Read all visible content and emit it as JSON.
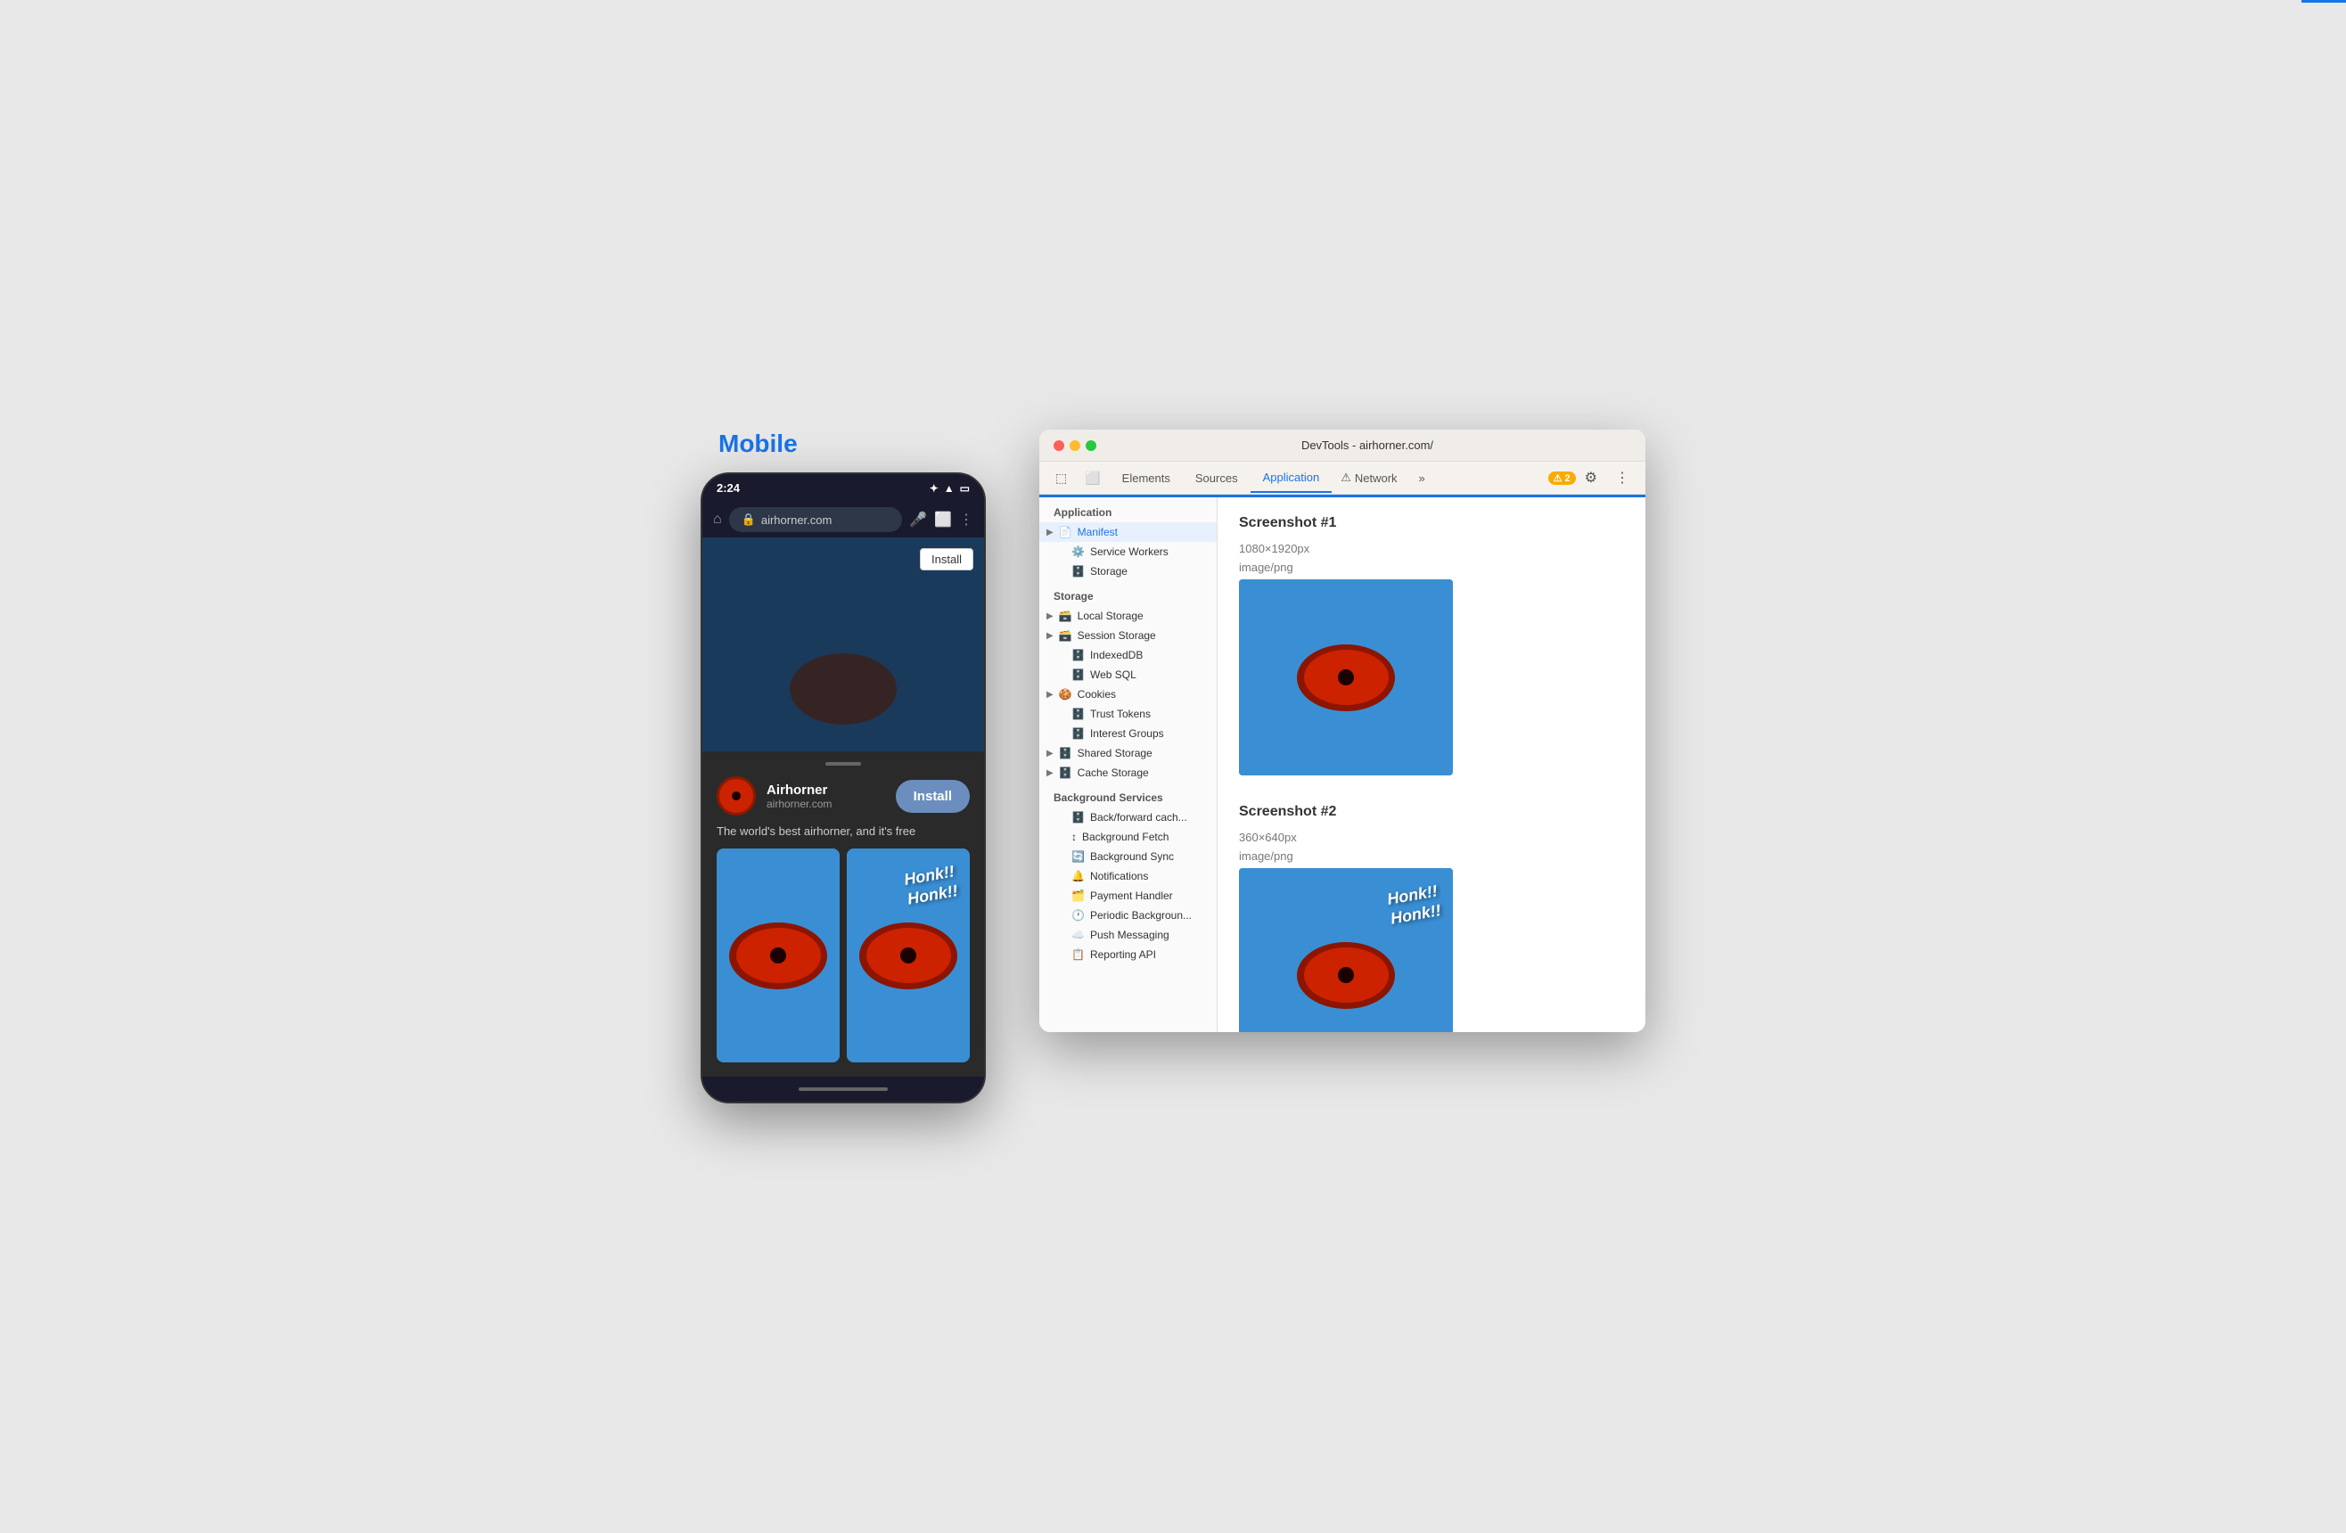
{
  "page": {
    "mobile_label": "Mobile"
  },
  "phone": {
    "status_time": "2:24",
    "url": "airhorner.com",
    "install_small": "Install",
    "app_name": "Airhorner",
    "app_url": "airhorner.com",
    "install_large": "Install",
    "description": "The world's best airhorner, and it's free",
    "honk_text_1": "Honk!!\nHonk!!",
    "honk_text_2": "Honk!!\nHonk!!"
  },
  "devtools": {
    "title": "DevTools - airhorner.com/",
    "tabs": [
      {
        "label": "Elements",
        "active": false
      },
      {
        "label": "Sources",
        "active": false
      },
      {
        "label": "Application",
        "active": true
      },
      {
        "label": "Network",
        "active": false
      }
    ],
    "warning_count": "⚠ 2",
    "sidebar": {
      "sections": [
        {
          "label": "Application",
          "items": [
            {
              "label": "Manifest",
              "icon": "📄",
              "expandable": true,
              "selected": false
            },
            {
              "label": "Service Workers",
              "icon": "⚙️",
              "expandable": false,
              "selected": false
            },
            {
              "label": "Storage",
              "icon": "🗄️",
              "expandable": false,
              "selected": false
            }
          ]
        },
        {
          "label": "Storage",
          "items": [
            {
              "label": "Local Storage",
              "icon": "🗃️",
              "expandable": true,
              "selected": false
            },
            {
              "label": "Session Storage",
              "icon": "🗃️",
              "expandable": true,
              "selected": false
            },
            {
              "label": "IndexedDB",
              "icon": "🗄️",
              "expandable": false,
              "selected": false
            },
            {
              "label": "Web SQL",
              "icon": "🗄️",
              "expandable": false,
              "selected": false
            },
            {
              "label": "Cookies",
              "icon": "🍪",
              "expandable": true,
              "selected": false
            },
            {
              "label": "Trust Tokens",
              "icon": "🗄️",
              "expandable": false,
              "selected": false
            },
            {
              "label": "Interest Groups",
              "icon": "🗄️",
              "expandable": false,
              "selected": false
            },
            {
              "label": "Shared Storage",
              "icon": "🗄️",
              "expandable": true,
              "selected": false
            },
            {
              "label": "Cache Storage",
              "icon": "🗄️",
              "expandable": true,
              "selected": false
            }
          ]
        },
        {
          "label": "Background Services",
          "items": [
            {
              "label": "Back/forward cache",
              "icon": "🗄️",
              "expandable": false,
              "selected": false
            },
            {
              "label": "Background Fetch",
              "icon": "↕",
              "expandable": false,
              "selected": false
            },
            {
              "label": "Background Sync",
              "icon": "🔄",
              "expandable": false,
              "selected": false
            },
            {
              "label": "Notifications",
              "icon": "🔔",
              "expandable": false,
              "selected": false
            },
            {
              "label": "Payment Handler",
              "icon": "🗂️",
              "expandable": false,
              "selected": false
            },
            {
              "label": "Periodic Background...",
              "icon": "🕐",
              "expandable": false,
              "selected": false
            },
            {
              "label": "Push Messaging",
              "icon": "☁️",
              "expandable": false,
              "selected": false
            },
            {
              "label": "Reporting API",
              "icon": "📋",
              "expandable": false,
              "selected": false
            }
          ]
        }
      ]
    },
    "main": {
      "screenshot1": {
        "title": "Screenshot #1",
        "dimensions": "1080×1920px",
        "type": "image/png"
      },
      "screenshot2": {
        "title": "Screenshot #2",
        "dimensions": "360×640px",
        "type": "image/png"
      }
    }
  }
}
